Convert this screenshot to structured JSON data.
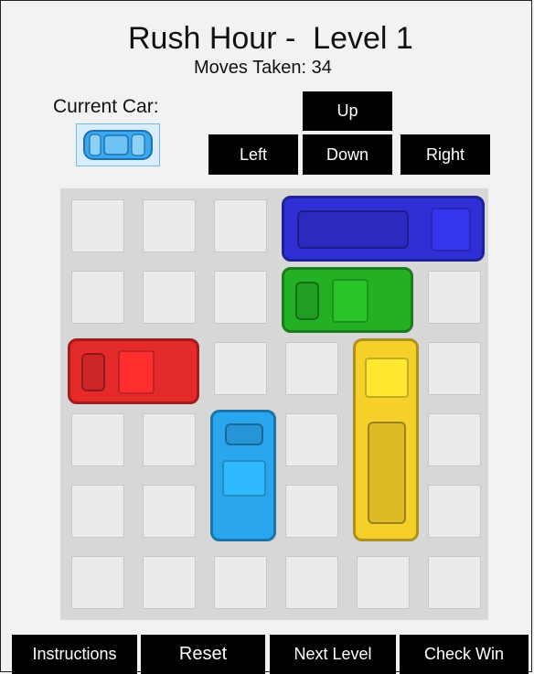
{
  "header": {
    "title": "Rush Hour -  Level 1",
    "moves_label": "Moves Taken: ",
    "moves_value": "34"
  },
  "current_car": {
    "label": "Current Car:",
    "color": "#3aa8ec"
  },
  "controls": {
    "up": "Up",
    "left": "Left",
    "down": "Down",
    "right": "Right"
  },
  "board": {
    "columns": 6,
    "rows": 6,
    "cars": [
      {
        "name": "blue-truck",
        "color": "#2f2fd6",
        "orientation": "horizontal",
        "row": 0,
        "col": 3,
        "length": 3
      },
      {
        "name": "green-car",
        "color": "#23b023",
        "orientation": "horizontal",
        "row": 1,
        "col": 3,
        "length": 2
      },
      {
        "name": "red-car",
        "color": "#e52a2a",
        "orientation": "horizontal",
        "row": 2,
        "col": 0,
        "length": 2
      },
      {
        "name": "yellow-truck",
        "color": "#f5cf2a",
        "orientation": "vertical",
        "row": 2,
        "col": 4,
        "length": 3
      },
      {
        "name": "light-blue-car",
        "color": "#2aa6ee",
        "orientation": "vertical",
        "row": 3,
        "col": 2,
        "length": 2
      }
    ]
  },
  "footer": {
    "instructions": "Instructions",
    "reset": "Reset",
    "next_level": "Next Level",
    "check_win": "Check Win"
  }
}
